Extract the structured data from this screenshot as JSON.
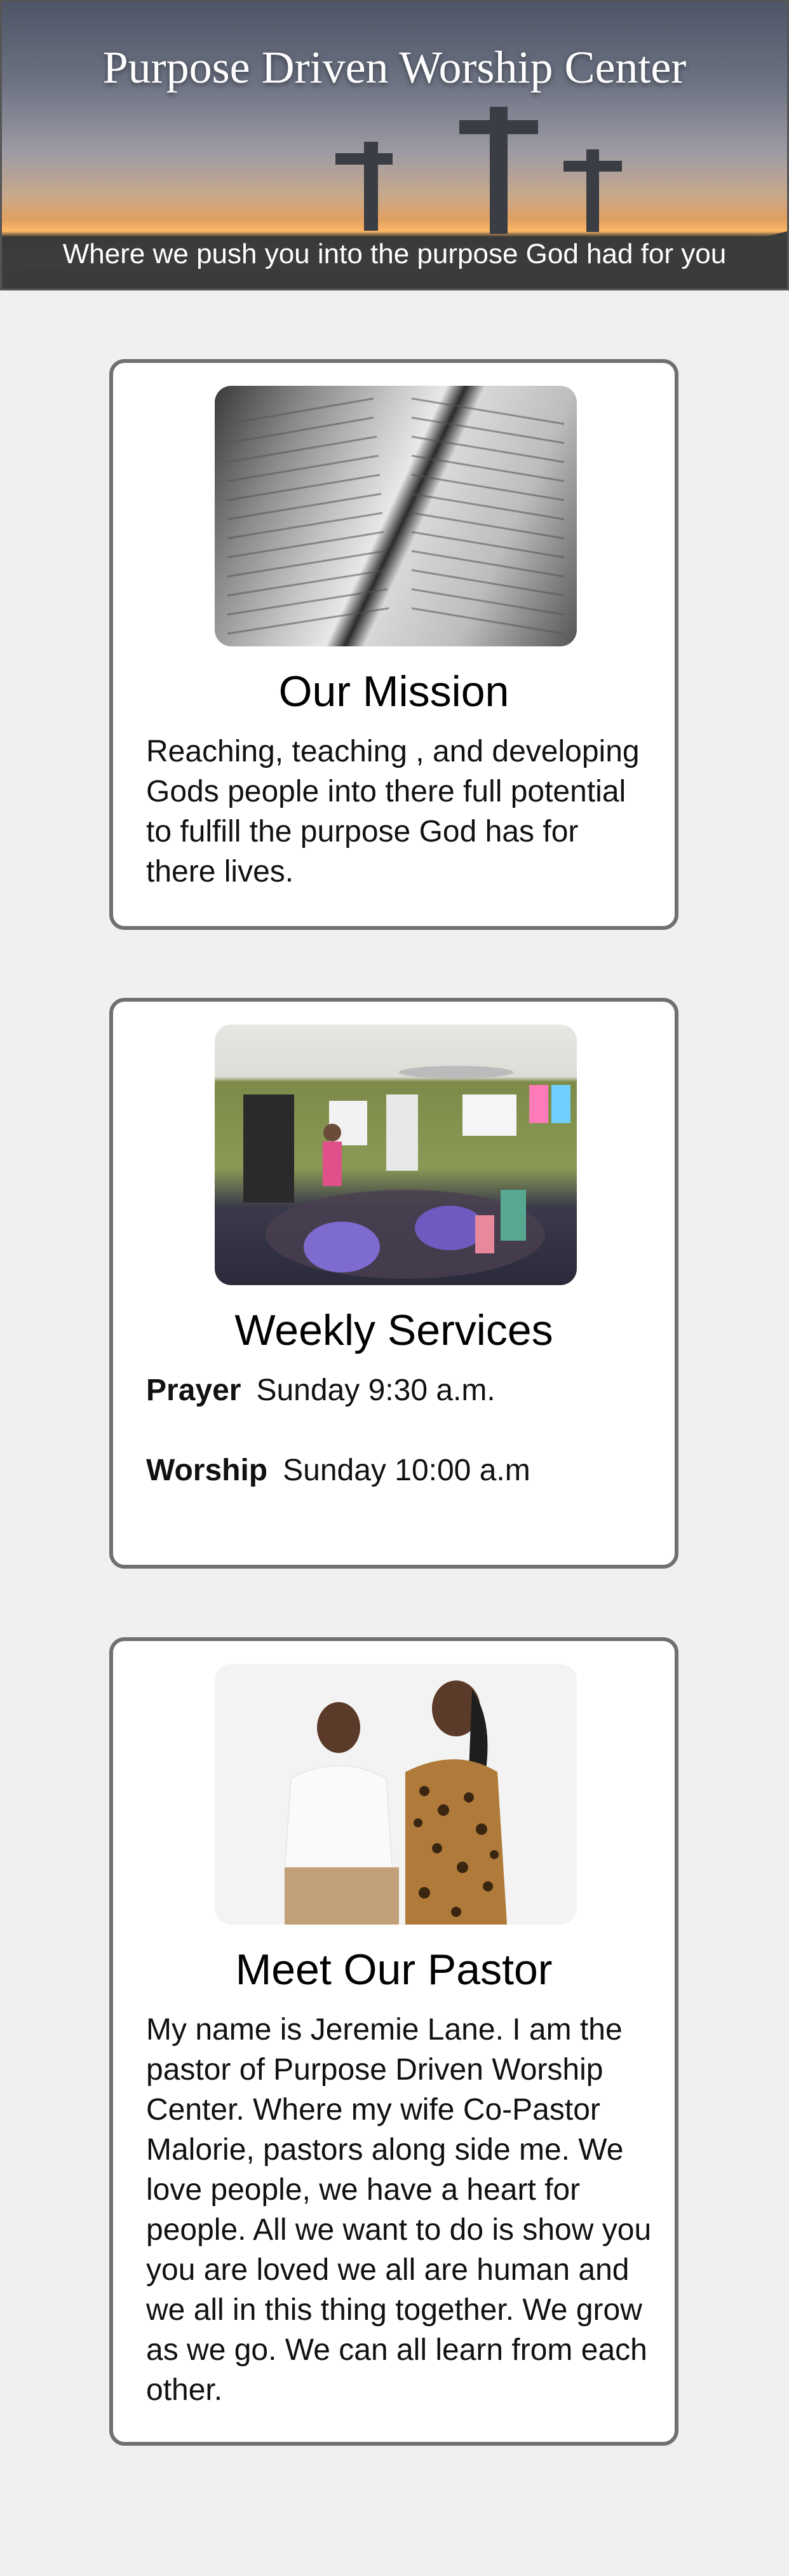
{
  "header": {
    "title": "Purpose Driven Worship Center",
    "tagline": "Where we push you into the purpose God had for you"
  },
  "mission": {
    "title": "Our Mission",
    "text": "Reaching, teaching , and developing Gods people into there full potential to fulfill the purpose God has for there lives."
  },
  "services": {
    "title": "Weekly Services",
    "items": [
      {
        "label": "Prayer",
        "time": "Sunday 9:30 a.m."
      },
      {
        "label": "Worship",
        "time": "Sunday 10:00 a.m"
      }
    ]
  },
  "pastor": {
    "title": "Meet Our Pastor",
    "text": "My name is Jeremie Lane. I am the pastor of Purpose Driven Worship Center. Where my wife Co-Pastor Malorie, pastors along side me. We love people, we have a heart for people. All we want to do is show you you are loved we all are human and we all in this thing together. We grow as we go. We can all learn from each other."
  }
}
